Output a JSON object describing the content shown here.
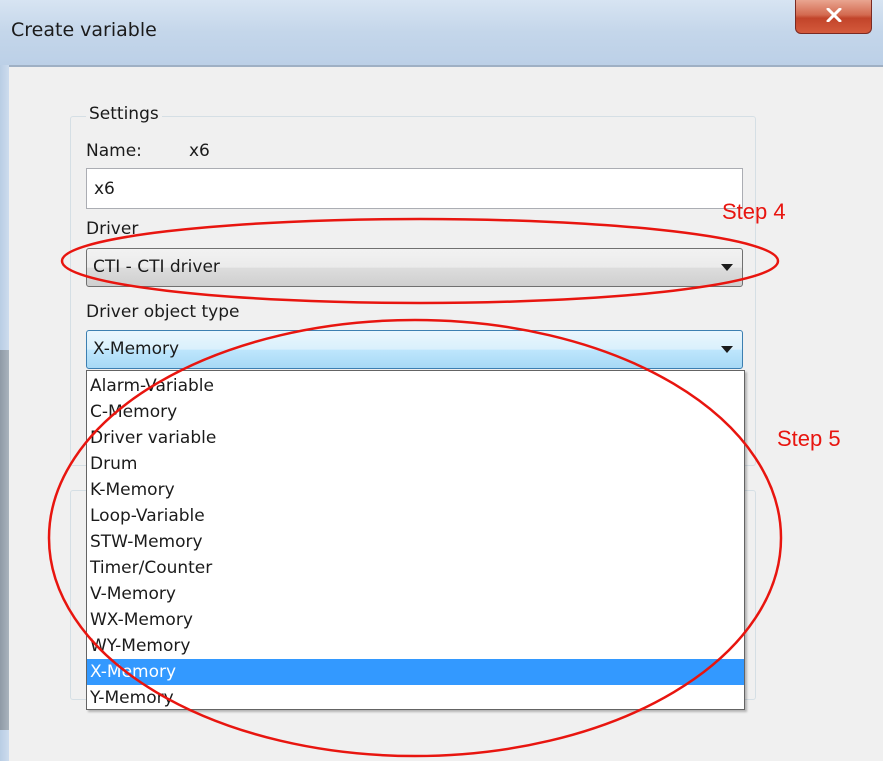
{
  "window": {
    "title": "Create variable"
  },
  "settings": {
    "legend": "Settings",
    "name_label": "Name:",
    "name_value_display": "x6",
    "name_input_value": "x6"
  },
  "driver": {
    "label": "Driver",
    "selected": "CTI - CTI driver"
  },
  "object_type": {
    "label": "Driver object type",
    "selected": "X-Memory",
    "options": [
      "Alarm-Variable",
      "C-Memory",
      "Driver variable",
      "Drum",
      "K-Memory",
      "Loop-Variable",
      "STW-Memory",
      "Timer/Counter",
      "V-Memory",
      "WX-Memory",
      "WY-Memory",
      "X-Memory",
      "Y-Memory"
    ],
    "highlighted_index": 11
  },
  "annotations": {
    "step4": "Step 4",
    "step5": "Step 5"
  },
  "colors": {
    "annotation": "#e8150f",
    "selection": "#3399ff",
    "titlebar": "#c4d6ea"
  }
}
